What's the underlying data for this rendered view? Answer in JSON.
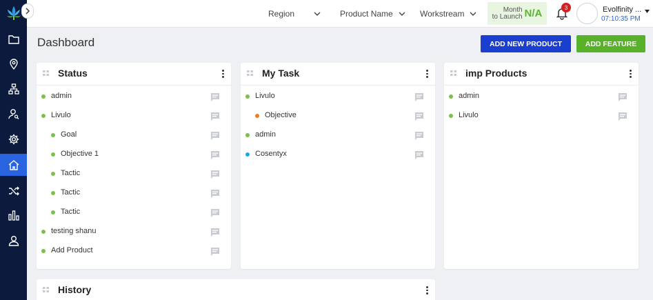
{
  "colors": {
    "sidebar_bg": "#0b1a3d",
    "accent_blue": "#2a63e0",
    "status_green": "#7cc04a",
    "status_orange": "#f07d1a",
    "status_cyan": "#18a9e6"
  },
  "sidebar": {
    "logo_icon": "lotus-logo-icon",
    "items": [
      {
        "icon": "folder-icon",
        "active": false
      },
      {
        "icon": "map-pin-icon",
        "active": false
      },
      {
        "icon": "hierarchy-icon",
        "active": false
      },
      {
        "icon": "user-search-icon",
        "active": false
      },
      {
        "icon": "gear-icon",
        "active": false
      },
      {
        "icon": "home-icon",
        "active": true
      },
      {
        "icon": "shuffle-icon",
        "active": false
      },
      {
        "icon": "bar-chart-icon",
        "active": false
      },
      {
        "icon": "user-icon",
        "active": false
      }
    ]
  },
  "header": {
    "filters": {
      "region": "Region",
      "product_name": "Product Name",
      "workstream": "Workstream"
    },
    "launch": {
      "line1": "Month",
      "line2": "to Launch",
      "value": "N/A"
    },
    "notifications": {
      "count": "3"
    },
    "user": {
      "name": "Evolfinity ...",
      "time": "07:10:35 PM"
    }
  },
  "page": {
    "title": "Dashboard",
    "add_product_label": "ADD NEW PRODUCT",
    "add_feature_label": "ADD FEATURE"
  },
  "status_card": {
    "title": "Status",
    "items": [
      {
        "label": "admin",
        "level": 0,
        "color": "green"
      },
      {
        "label": "Livulo",
        "level": 0,
        "color": "green"
      },
      {
        "label": "Goal",
        "level": 1,
        "color": "green"
      },
      {
        "label": "Objective 1",
        "level": 1,
        "color": "green"
      },
      {
        "label": "Tactic",
        "level": 1,
        "color": "green"
      },
      {
        "label": "Tactic",
        "level": 1,
        "color": "green"
      },
      {
        "label": "Tactic",
        "level": 1,
        "color": "green"
      },
      {
        "label": "testing shanu",
        "level": 0,
        "color": "green"
      },
      {
        "label": "Add Product",
        "level": 0,
        "color": "green"
      }
    ]
  },
  "task_card": {
    "title": "My Task",
    "items": [
      {
        "label": "Livulo",
        "level": 0,
        "color": "green"
      },
      {
        "label": "Objective",
        "level": 1,
        "color": "orange"
      },
      {
        "label": "admin",
        "level": 0,
        "color": "green"
      },
      {
        "label": "Cosentyx",
        "level": 0,
        "color": "cyan"
      }
    ]
  },
  "products_card": {
    "title": "imp Products",
    "items": [
      {
        "label": "admin",
        "level": 0,
        "color": "green"
      },
      {
        "label": "Livulo",
        "level": 0,
        "color": "green"
      }
    ]
  },
  "history_card": {
    "title": "History"
  }
}
